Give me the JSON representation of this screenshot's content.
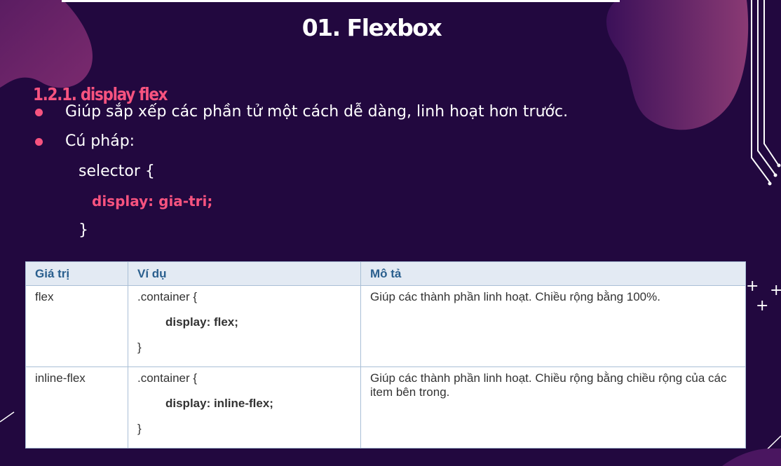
{
  "slide": {
    "title": "01. Flexbox",
    "subtitle": "1.2.1. display flex",
    "bullets": [
      "Giúp sắp xếp các phần tử một cách dễ dàng, linh hoạt hơn trước.",
      "Cú pháp:"
    ],
    "code": {
      "open": "selector {",
      "decl": "display: gia-tri;",
      "close": "}"
    }
  },
  "table": {
    "headers": [
      "Giá trị",
      "Ví dụ",
      "Mô tả"
    ],
    "rows": [
      {
        "value": "flex",
        "example_open": ".container {",
        "example_decl": "display: flex;",
        "example_close": "}",
        "description": "Giúp các thành phần linh hoạt. Chiều rộng bằng 100%."
      },
      {
        "value": "inline-flex",
        "example_open": ".container {",
        "example_decl": "display: inline-flex;",
        "example_close": "}",
        "description": "Giúp các thành phần linh hoạt. Chiều rộng bằng chiều rộng của các item bên trong."
      }
    ]
  },
  "colors": {
    "background": "#22083f",
    "accent": "#f7537f",
    "blob": "#5a1c5e",
    "header_bg": "#e3eaf3",
    "header_text": "#2a5f8e"
  }
}
